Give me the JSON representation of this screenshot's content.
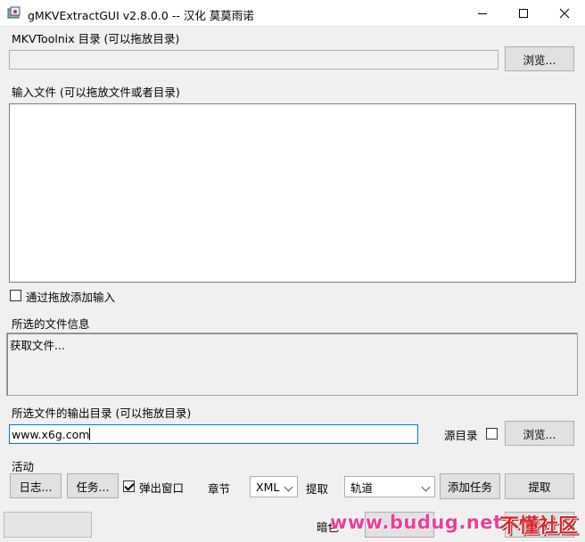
{
  "window": {
    "title": "gMKVExtractGUI v2.8.0.0 -- 汉化 莫莫雨诺"
  },
  "mkvtoolnix": {
    "label": "MKVToolnix 目录 (可以拖放目录)",
    "value": "",
    "browse_label": "浏览..."
  },
  "input": {
    "label": "输入文件 (可以拖放文件或者目录)",
    "append_checkbox_label": "通过拖放添加输入",
    "append_checked": false
  },
  "file_info": {
    "label": "所选的文件信息",
    "text": "获取文件..."
  },
  "output": {
    "label": "所选文件的输出目录 (可以拖放目录)",
    "value": "www.x6g.com",
    "source_dir_label": "源目录",
    "source_dir_checked": false,
    "browse_label": "浏览..."
  },
  "actions": {
    "label": "活动",
    "log_label": "日志...",
    "jobs_label": "任务...",
    "popup_label": "弹出窗口",
    "popup_checked": true,
    "chapters_label": "章节",
    "chapters_format": "XML",
    "extract_label": "提取",
    "extract_mode": "轨道",
    "add_job_label": "添加任务",
    "extract_button_label": "提取"
  },
  "status": {
    "dark_mode_label": "暗色"
  },
  "watermark": {
    "text": "www.budug.net",
    "text2": "不懂社区"
  },
  "colors": {
    "window_bg": "#f0f0f0",
    "textbox_border": "#7a7a7a",
    "active_textbox_border": "#0078d7",
    "watermark_pink": "#e8419a",
    "watermark_red": "#d9262c"
  }
}
